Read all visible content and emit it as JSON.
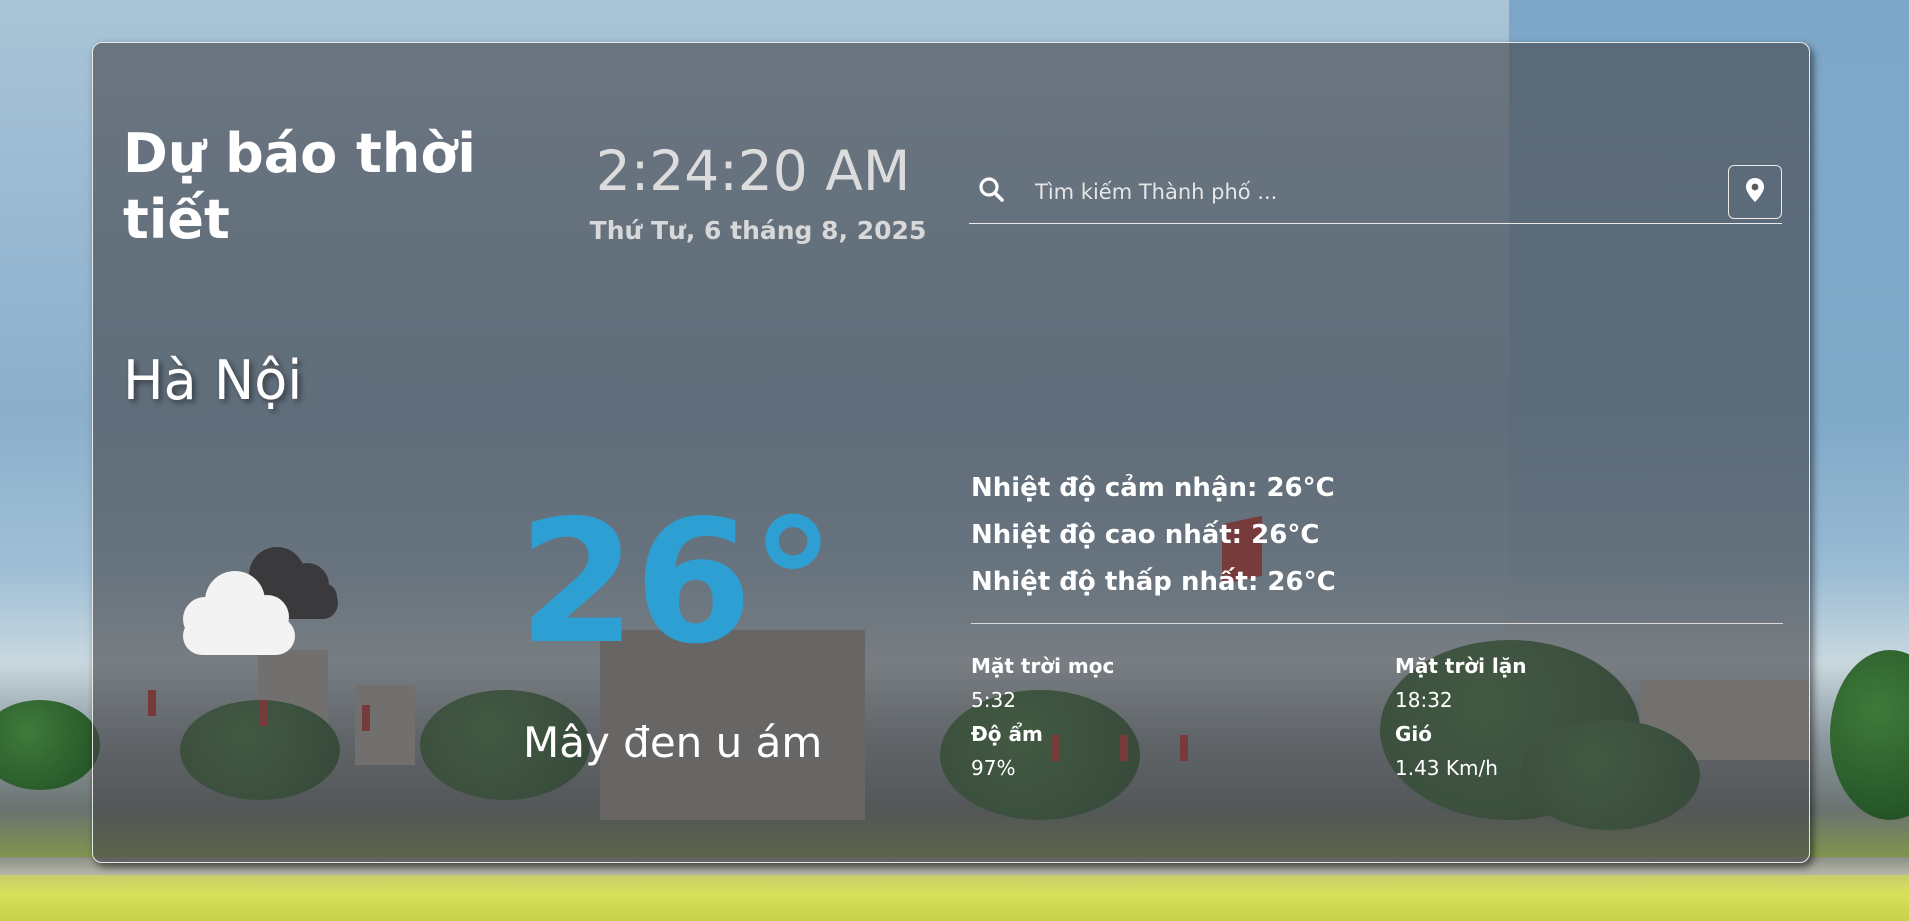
{
  "header": {
    "title": "Dự báo thời tiết",
    "time": "2:24:20 AM",
    "date": "Thứ Tư, 6 tháng 8, 2025"
  },
  "search": {
    "placeholder": "Tìm kiếm Thành phố ...",
    "value": ""
  },
  "current": {
    "city": "Hà Nội",
    "temperature": "26°",
    "condition": "Mây đen u ám",
    "icon": "cloud-icon"
  },
  "details": {
    "feels_like": "Nhiệt độ cảm nhận: 26°C",
    "high": "Nhiệt độ cao nhất: 26°C",
    "low": "Nhiệt độ thấp nhất: 26°C"
  },
  "stats": {
    "sunrise": {
      "label": "Mặt trời mọc",
      "value": "5:32"
    },
    "sunset": {
      "label": "Mặt trời lặn",
      "value": "18:32"
    },
    "humidity": {
      "label": "Độ ẩm",
      "value": "97%"
    },
    "wind": {
      "label": "Gió",
      "value": "1.43 Km/h"
    }
  },
  "colors": {
    "temperature": "#2e9fd2",
    "card_overlay": "rgba(70,70,72,0.62)"
  }
}
